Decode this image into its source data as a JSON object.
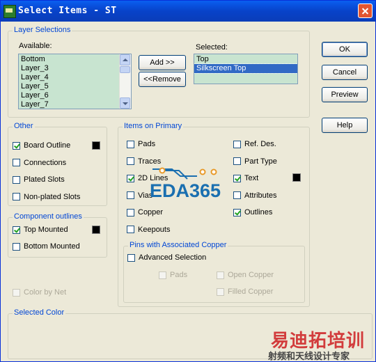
{
  "window": {
    "title": "Select Items - ST",
    "icon_name": "pads-app-icon"
  },
  "layer_selections": {
    "group_label": "Layer Selections",
    "available_label": "Available:",
    "available_items": [
      "Bottom",
      "Layer_3",
      "Layer_4",
      "Layer_5",
      "Layer_6",
      "Layer_7"
    ],
    "selected_label": "Selected:",
    "selected_items": [
      "Top",
      "Silkscreen Top"
    ],
    "selected_highlight": "Silkscreen Top",
    "add_button": "Add >>",
    "remove_button": "<<Remove"
  },
  "buttons": {
    "ok": "OK",
    "cancel": "Cancel",
    "preview": "Preview",
    "help": "Help"
  },
  "other": {
    "group_label": "Other",
    "items": [
      {
        "label": "Board Outline",
        "checked": true
      },
      {
        "label": "Connections",
        "checked": false
      },
      {
        "label": "Plated Slots",
        "checked": false
      },
      {
        "label": "Non-plated Slots",
        "checked": false
      }
    ]
  },
  "component_outlines": {
    "group_label": "Component outlines",
    "items": [
      {
        "label": "Top Mounted",
        "checked": true
      },
      {
        "label": "Bottom Mounted",
        "checked": false
      }
    ]
  },
  "color_by_net": {
    "label": "Color by Net",
    "checked": false,
    "disabled": true
  },
  "items_on_primary": {
    "group_label": "Items on Primary",
    "left": [
      {
        "label": "Pads",
        "checked": false
      },
      {
        "label": "Traces",
        "checked": false
      },
      {
        "label": "2D Lines",
        "checked": true
      },
      {
        "label": "Vias",
        "checked": false
      },
      {
        "label": "Copper",
        "checked": false
      },
      {
        "label": "Keepouts",
        "checked": false
      }
    ],
    "right": [
      {
        "label": "Ref. Des.",
        "checked": false
      },
      {
        "label": "Part Type",
        "checked": false
      },
      {
        "label": "Text",
        "checked": true
      },
      {
        "label": "Attributes",
        "checked": false
      },
      {
        "label": "Outlines",
        "checked": true
      }
    ]
  },
  "pins_copper": {
    "group_label": "Pins with Associated Copper",
    "advanced": {
      "label": "Advanced Selection",
      "checked": false
    },
    "pads": {
      "label": "Pads",
      "checked": false
    },
    "open_copper": {
      "label": "Open Copper",
      "checked": false
    },
    "filled_copper": {
      "label": "Filled Copper",
      "checked": false
    }
  },
  "selected_color": {
    "group_label": "Selected Color"
  },
  "watermarks": {
    "eda": "EDA365",
    "training": "易迪拓培训",
    "training_sub": "射频和天线设计专家"
  },
  "colors": {
    "group_label": "#0046d5",
    "list_bg": "#c8e4d0",
    "selection": "#316ac5",
    "titlebar": "#0842c9"
  }
}
